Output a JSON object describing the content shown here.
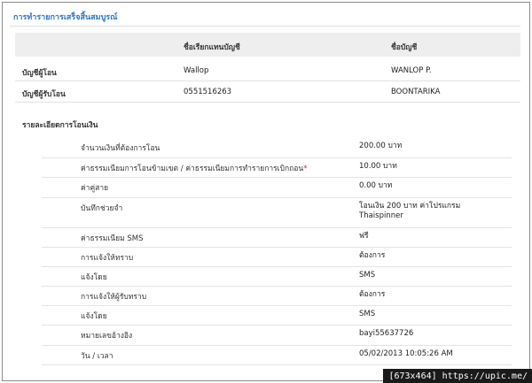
{
  "page": {
    "title": "การทำรายการเสร็จสิ้นสมบูรณ์"
  },
  "accounts": {
    "headers": [
      "ชื่อเรียกแทนบัญชี",
      "ชื่อบัญชี"
    ],
    "rows": [
      {
        "label": "บัญชีผู้โอน",
        "nickname": "Wallop",
        "name": "WANLOP P."
      },
      {
        "label": "บัญชีผู้รับโอน",
        "nickname": "0551516263",
        "name": "BOONTARIKA"
      }
    ]
  },
  "details": {
    "title": "รายละเอียดการโอนเงิน",
    "rows": [
      {
        "label": "จำนวนเงินที่ต้องการโอน",
        "value": "200.00 บาท",
        "value2": ""
      },
      {
        "label": "ค่าธรรมเนียมการโอนข้ามเขต / ค่าธรรมเนียมการทำรายการเบิกถอน",
        "required_mark": "*",
        "value": "10.00 บาท",
        "value2": ""
      },
      {
        "label": "ค่าคู่สาย",
        "value": "0.00 บาท",
        "value2": ""
      },
      {
        "label": "บันทึกช่วยจำ",
        "value": "โอนเงิน 200 บาท ค่าโปรแกรม",
        "value2": "Thaispinner"
      },
      {
        "label": "ค่าธรรมเนียม SMS",
        "value": "ฟรี",
        "value2": ""
      },
      {
        "label": "การแจ้งให้ทราบ",
        "value": "ต้องการ",
        "value2": ""
      },
      {
        "label": "แจ้งโดย",
        "value": "SMS",
        "value2": ""
      },
      {
        "label": "การแจ้งให้ผู้รับทราบ",
        "value": "ต้องการ",
        "value2": ""
      },
      {
        "label": "แจ้งโดย",
        "value": "SMS",
        "value2": ""
      },
      {
        "label": "หมายเลขอ้างอิง",
        "value": "bayi55637726",
        "value2": ""
      },
      {
        "label": "วัน / เวลา",
        "value": "05/02/2013 10:05:26 AM",
        "value2": ""
      }
    ]
  },
  "watermark": "[673x464] https://upic.me/",
  "colors": {
    "title": "#2b79c2",
    "header_bg": "#eeeeee",
    "required": "#d32222"
  }
}
